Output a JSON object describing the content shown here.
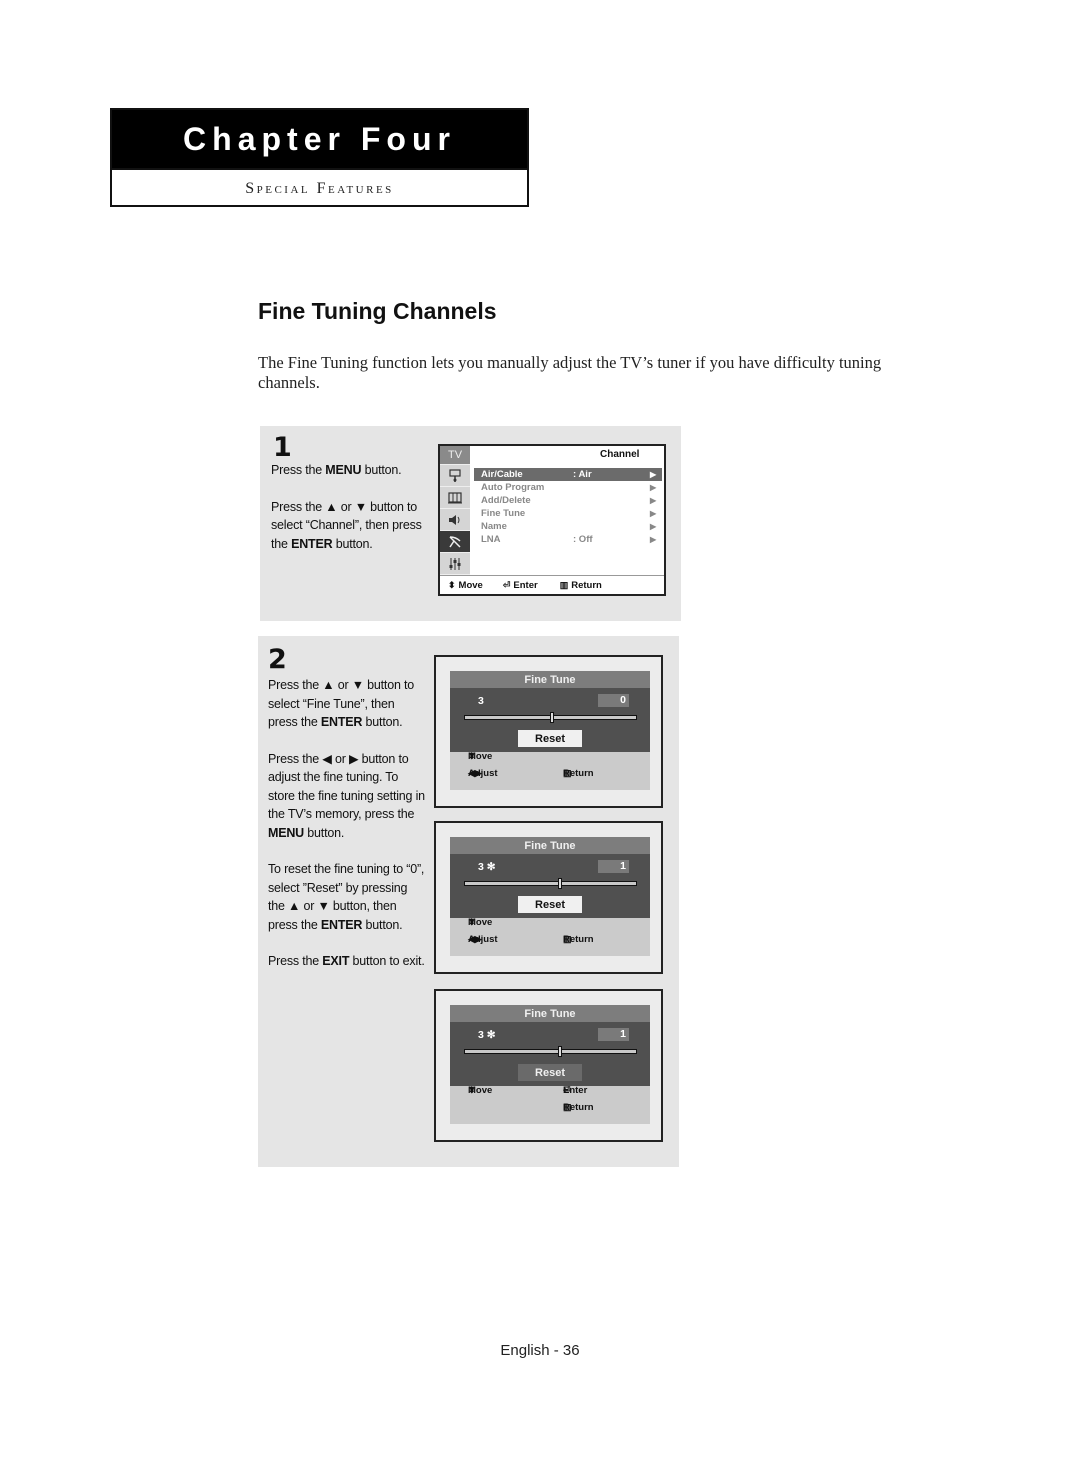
{
  "chapter": {
    "title": "Chapter Four",
    "subtitle": "Special Features"
  },
  "page": {
    "title": "Fine Tuning Channels",
    "intro": "The Fine Tuning function lets you manually adjust the TV’s tuner if you have difficulty tuning channels.",
    "footer": "English - 36"
  },
  "step1": {
    "number": "1",
    "p1": {
      "a": "Press the ",
      "b": "MENU",
      "c": " button."
    },
    "p2": {
      "a": "Press the ▲ or ▼ button to select “Channel”, then press the ",
      "b": "ENTER",
      "c": " button."
    }
  },
  "step2": {
    "number": "2",
    "p1": {
      "a": "Press the ▲ or ▼ button to select “Fine Tune”, then press the ",
      "b": "ENTER",
      "c": " button."
    },
    "p2": {
      "a": "Press the ◀ or ▶ button to adjust the fine tuning. To store the fine tuning setting in the TV’s memory, press the ",
      "b": "MENU",
      "c": " button."
    },
    "p3": {
      "a": "To reset the fine tuning to “0”, select ”Reset” by pressing the ▲ or ▼ button, then press the ",
      "b": "ENTER",
      "c": " button."
    },
    "p4": {
      "a": "Press the ",
      "b": "EXIT",
      "c": " button to exit."
    }
  },
  "tv_menu": {
    "sidebar_label": "TV",
    "sidebar_icons": [
      "input-icon",
      "picture-icon",
      "sound-icon",
      "channel-antenna-icon",
      "setup-icon"
    ],
    "active_sidebar": "channel-antenna-icon",
    "header": "Channel",
    "items": [
      {
        "label": "Air/Cable",
        "value": ": Air",
        "arrow": "▶",
        "selected": true
      },
      {
        "label": "Auto Program",
        "value": "",
        "arrow": "▶"
      },
      {
        "label": "Add/Delete",
        "value": "",
        "arrow": "▶"
      },
      {
        "label": "Fine Tune",
        "value": "",
        "arrow": "▶"
      },
      {
        "label": "Name",
        "value": "",
        "arrow": "▶"
      },
      {
        "label": "LNA",
        "value": ": Off",
        "arrow": "▶"
      }
    ],
    "footer": {
      "move": "Move",
      "enter": "Enter",
      "return": "Return"
    }
  },
  "fine_tune_screens": [
    {
      "title": "Fine Tune",
      "channel": "3",
      "value": "0",
      "slider_position": 0.5,
      "reset": "Reset",
      "reset_highlighted": true,
      "help": {
        "move": "Move",
        "adjust": "Adjust",
        "return": "Return"
      }
    },
    {
      "title": "Fine Tune",
      "channel": "3 ✻",
      "value": "1",
      "slider_position": 0.55,
      "reset": "Reset",
      "reset_highlighted": true,
      "help": {
        "move": "Move",
        "adjust": "Adjust",
        "return": "Return"
      }
    },
    {
      "title": "Fine Tune",
      "channel": "3 ✻",
      "value": "1",
      "slider_position": 0.55,
      "reset": "Reset",
      "reset_highlighted": false,
      "help": {
        "move": "Move",
        "enter": "Enter",
        "return": "Return"
      }
    }
  ]
}
